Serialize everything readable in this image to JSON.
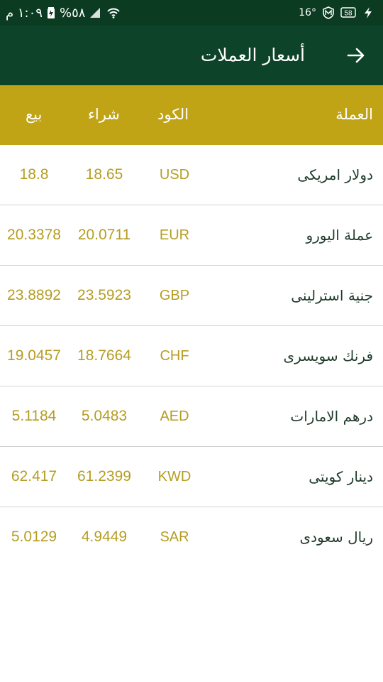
{
  "colors": {
    "statusbar_bg": "#0b3b20",
    "appbar_bg": "#0d4429",
    "header_bg": "#c1a416",
    "value_text": "#b59d22",
    "name_text": "#1f3b2b",
    "divider": "#d3d3d3"
  },
  "statusbar": {
    "time": "١:٠٩ م",
    "battery_percent": "%٥٨",
    "temperature": "16°",
    "notification_count": "58",
    "icons": [
      "battery-charging-icon",
      "signal-icon",
      "wifi-icon",
      "shield-icon",
      "message-icon",
      "flash-icon"
    ]
  },
  "appbar": {
    "title": "أسعار العملات",
    "back_icon": "arrow-back-icon"
  },
  "table": {
    "headers": {
      "currency": "العملة",
      "code": "الكود",
      "buy": "شراء",
      "sell": "بيع"
    },
    "rows": [
      {
        "name": "دولار امريكى",
        "code": "USD",
        "buy": "18.65",
        "sell": "18.8"
      },
      {
        "name": "عملة اليورو",
        "code": "EUR",
        "buy": "20.0711",
        "sell": "20.3378"
      },
      {
        "name": "جنية استرلينى",
        "code": "GBP",
        "buy": "23.5923",
        "sell": "23.8892"
      },
      {
        "name": "فرنك سويسرى",
        "code": "CHF",
        "buy": "18.7664",
        "sell": "19.0457"
      },
      {
        "name": "درهم الامارات",
        "code": "AED",
        "buy": "5.0483",
        "sell": "5.1184"
      },
      {
        "name": "دينار كويتى",
        "code": "KWD",
        "buy": "61.2399",
        "sell": "62.417"
      },
      {
        "name": "ريال سعودى",
        "code": "SAR",
        "buy": "4.9449",
        "sell": "5.0129"
      }
    ]
  }
}
